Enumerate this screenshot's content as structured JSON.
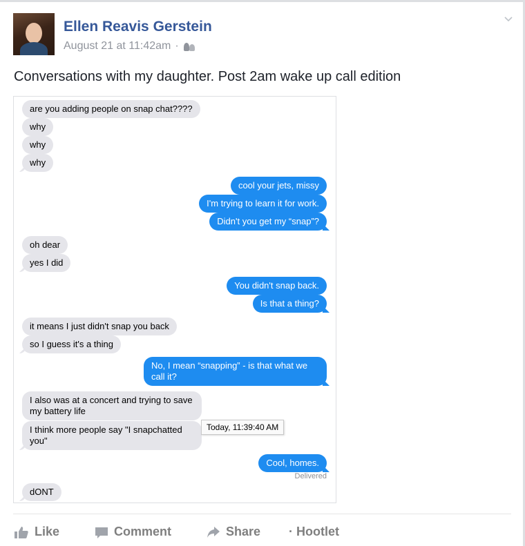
{
  "post": {
    "author": "Ellen Reavis Gerstein",
    "timestamp": "August 21 at 11:42am",
    "separator": "·",
    "audience_icon": "friends-icon",
    "text": "Conversations with my daughter. Post 2am wake up call edition"
  },
  "chat": {
    "messages": [
      {
        "side": "in",
        "text": "are you adding people on snap chat????"
      },
      {
        "side": "in",
        "text": "why"
      },
      {
        "side": "in",
        "text": "why"
      },
      {
        "side": "in",
        "text": "why"
      },
      {
        "side": "out",
        "text": "cool your jets, missy"
      },
      {
        "side": "out",
        "text": "I'm trying to learn it for work."
      },
      {
        "side": "out",
        "text": "Didn't you get my “snap”?"
      },
      {
        "side": "in",
        "text": "oh dear"
      },
      {
        "side": "in",
        "text": "yes I did"
      },
      {
        "side": "out",
        "text": "You didn't snap back."
      },
      {
        "side": "out",
        "text": "Is that a thing?"
      },
      {
        "side": "in",
        "text": "it means I just didn't snap you back"
      },
      {
        "side": "in",
        "text": "so I guess it's a thing"
      },
      {
        "side": "out",
        "text": "No, I mean “snapping” - is that what we call it?"
      },
      {
        "side": "in",
        "text": "I also was at a concert and trying to save my battery life"
      },
      {
        "side": "in",
        "text": "I think more people say \"I snapchatted you\""
      },
      {
        "side": "out",
        "text": "Cool, homes."
      },
      {
        "side": "in",
        "text": "dONT"
      }
    ],
    "delivered": "Delivered",
    "tooltip": "Today, 11:39:40 AM",
    "colors": {
      "incoming": "#e5e5ea",
      "outgoing": "#1e8cf0"
    }
  },
  "actions": {
    "like": "Like",
    "comment": "Comment",
    "share": "Share",
    "hootlet": "· Hootlet"
  },
  "colors": {
    "name": "#365899",
    "meta": "#90949c",
    "action": "#7f7f7f"
  }
}
